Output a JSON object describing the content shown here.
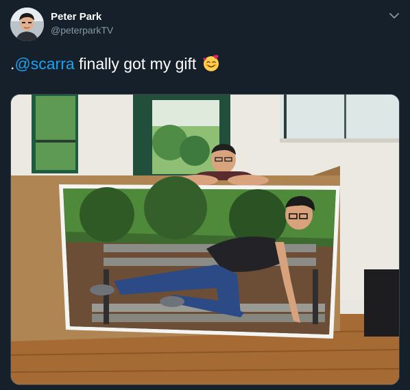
{
  "tweet": {
    "author_name": "Peter Park",
    "author_handle": "@peterparkTV",
    "text_prefix": ".",
    "mention": "@scarra",
    "text_body": " finally got my gift",
    "emoji_icon": "smiling-face-with-hearts-icon"
  },
  "colors": {
    "background": "#15202b",
    "text": "#ffffff",
    "secondary_text": "#8899a6",
    "link": "#1da1f2"
  }
}
